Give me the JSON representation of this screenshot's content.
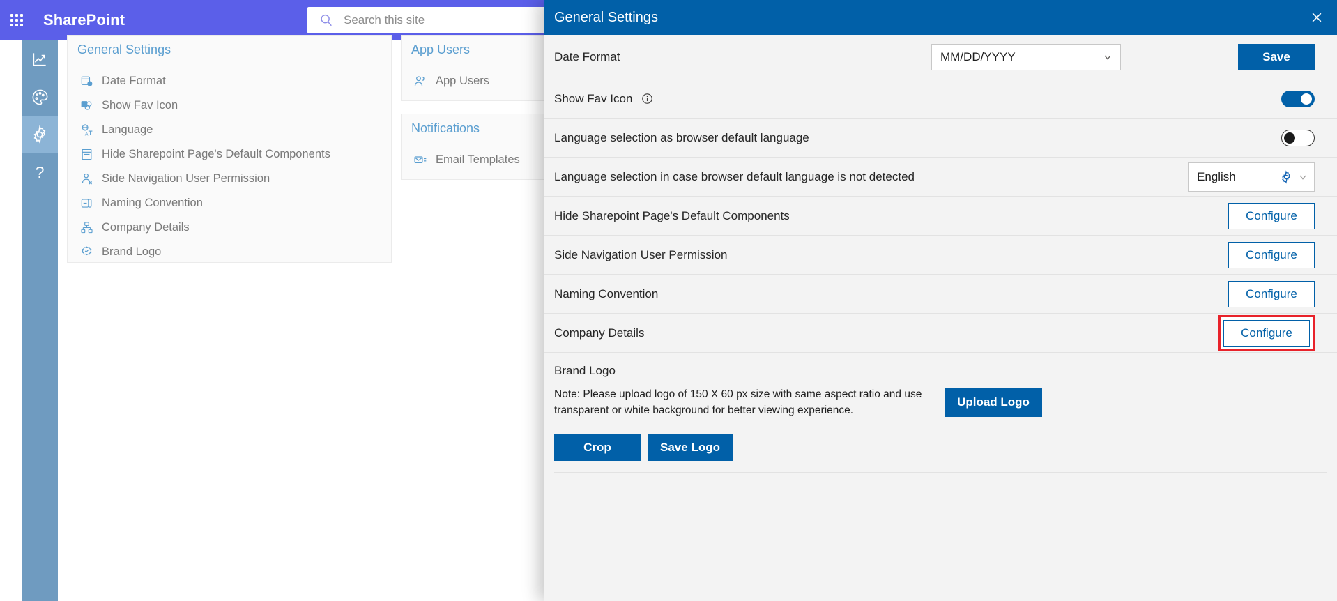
{
  "suite": {
    "waffle_label": "app-launcher",
    "title": "SharePoint",
    "search_placeholder": "Search this site"
  },
  "rail": {
    "items": [
      {
        "label": "analytics",
        "icon": "chart-line-icon",
        "active": false
      },
      {
        "label": "theme",
        "icon": "palette-icon",
        "active": false
      },
      {
        "label": "settings",
        "icon": "gear-icon",
        "active": true
      },
      {
        "label": "help",
        "icon": "question-icon",
        "active": false
      }
    ]
  },
  "general_card": {
    "title": "General Settings",
    "items": [
      {
        "label": "Date Format",
        "icon": "date-time-icon"
      },
      {
        "label": "Show Fav Icon",
        "icon": "favicon-icon"
      },
      {
        "label": "Language",
        "icon": "language-icon"
      },
      {
        "label": "Hide Sharepoint Page's Default Components",
        "icon": "page-icon"
      },
      {
        "label": "Side Navigation User Permission",
        "icon": "user-permission-icon"
      },
      {
        "label": "Naming Convention",
        "icon": "naming-icon"
      },
      {
        "label": "Company Details",
        "icon": "org-chart-icon"
      },
      {
        "label": "Brand Logo",
        "icon": "badge-icon"
      }
    ]
  },
  "app_users_card": {
    "title": "App Users",
    "items": [
      {
        "label": "App Users",
        "icon": "people-icon"
      }
    ]
  },
  "notifications_card": {
    "title": "Notifications",
    "items": [
      {
        "label": "Email Templates",
        "icon": "mail-template-icon"
      }
    ]
  },
  "panel": {
    "title": "General Settings",
    "close_label": "close-icon",
    "rows": {
      "date_format": {
        "label": "Date Format",
        "value": "MM/DD/YYYY",
        "save_label": "Save"
      },
      "show_fav_icon": {
        "label": "Show Fav Icon",
        "info_icon": "info-icon",
        "toggle_state": "on"
      },
      "lang_browser_default": {
        "label": "Language selection as browser default language",
        "toggle_state": "off"
      },
      "lang_not_detected": {
        "label": "Language selection in case browser default language is not detected",
        "value": "English",
        "gear_icon": "gear-icon"
      },
      "hide_components": {
        "label": "Hide Sharepoint Page's Default Components",
        "button_label": "Configure"
      },
      "side_nav_permission": {
        "label": "Side Navigation User Permission",
        "button_label": "Configure"
      },
      "naming_convention": {
        "label": "Naming Convention",
        "button_label": "Configure"
      },
      "company_details": {
        "label": "Company Details",
        "button_label": "Configure",
        "highlighted": true
      },
      "brand_logo": {
        "label": "Brand Logo",
        "note": "Note: Please upload logo of 150 X 60 px size with same aspect ratio and use transparent or white background for better viewing experience.",
        "upload_label": "Upload Logo",
        "crop_label": "Crop",
        "save_logo_label": "Save Logo"
      }
    }
  },
  "colors": {
    "suite_bar": "#5b5fe9",
    "panel_header": "#0160a8",
    "accent_blue": "#0160a8",
    "rail": "#6f9bc0",
    "rail_active": "#8cb4d6",
    "highlight_red": "#e8222a",
    "card_title_blue": "#5a9ed0"
  }
}
